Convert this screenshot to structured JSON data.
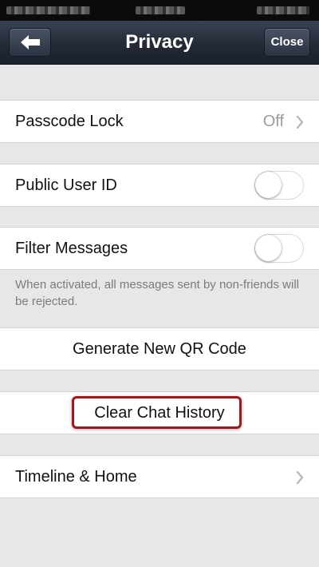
{
  "header": {
    "title": "Privacy",
    "close_label": "Close"
  },
  "rows": [
    {
      "label": "Passcode Lock",
      "value": "Off"
    },
    {
      "label": "Public User ID",
      "toggle": "off"
    },
    {
      "label": "Filter Messages",
      "toggle": "off"
    },
    {
      "label": "Generate New QR Code"
    },
    {
      "label": "Clear Chat History"
    },
    {
      "label": "Timeline & Home"
    }
  ],
  "filter_note": "When activated, all messages sent by non-friends will be rejected.",
  "colors": {
    "nav_bar": "#232a36",
    "background": "#e7e7e9",
    "highlight": "#a3171c"
  },
  "icons": [
    "back-arrow-icon",
    "chevron-right-icon"
  ]
}
